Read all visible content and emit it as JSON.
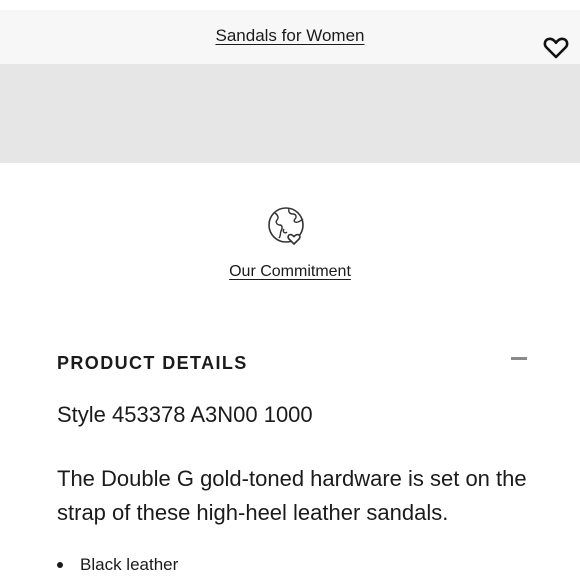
{
  "header": {
    "breadcrumb_label": "Sandals for Women",
    "wishlist_icon": "heart-icon"
  },
  "commitment": {
    "icon": "globe-heart-icon",
    "label": "Our Commitment"
  },
  "product_details": {
    "heading": "PRODUCT DETAILS",
    "toggle_icon": "minus-icon",
    "style_number": "Style 453378 A3N00 1000",
    "description": "The Double G gold-toned hardware is set on the strap of these high-heel leather sandals.",
    "features": [
      "Black leather"
    ]
  }
}
